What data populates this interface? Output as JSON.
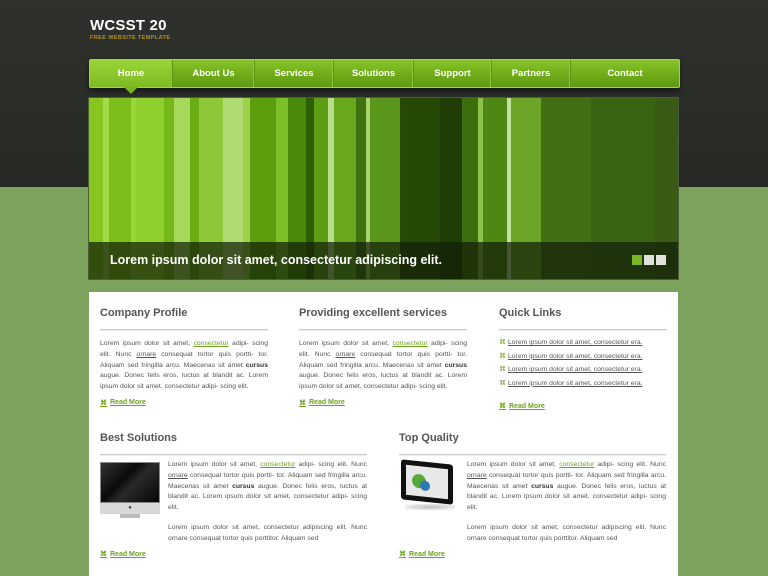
{
  "brand": {
    "title": "WCSST 20",
    "tagline": "FREE WEBSITE TEMPLATE"
  },
  "nav": {
    "items": [
      {
        "label": "Home",
        "active": true
      },
      {
        "label": "About Us"
      },
      {
        "label": "Services"
      },
      {
        "label": "Solutions"
      },
      {
        "label": "Support"
      },
      {
        "label": "Partners"
      },
      {
        "label": "Contact"
      }
    ]
  },
  "slider": {
    "caption": "Lorem ipsum dolor sit amet, consectetur adipiscing elit.",
    "slides": 3,
    "active_slide": 1,
    "stripe_colors": [
      "#86c61f",
      "#a3dc4a",
      "#7dbe1a",
      "#9ad53a",
      "#8fcf2c",
      "#76b817",
      "#a6d95b",
      "#6aad12",
      "#8ec83a",
      "#b0db74",
      "#9bd247",
      "#5c9e0d",
      "#7cbf28",
      "#4a8a0a",
      "#2f5f05",
      "#5d9e17",
      "#b8dd8b",
      "#6aa81d",
      "#3f7310",
      "#a9d46c",
      "#5a961a",
      "#264a06",
      "#1f3d05",
      "#3d6e0e",
      "#8dc24a",
      "#4e8714",
      "#c2e39b",
      "#6da627",
      "#426f14",
      "#3a6412"
    ]
  },
  "profile": {
    "title": "Company Profile",
    "p1": "Lorem ipsum dolor sit amet, ",
    "link": "consectetur",
    "p2": " adipi- scing elit. Nunc ",
    "u": "ornare",
    "p3": " consequat tortor quis portti- tor. Aliquam sed fringilla arcu. Maecenas sit amet ",
    "b": "cursus",
    "p4": " augue. Donec felis eros, luctus at blandit ac. Lorem ipsum dolor sit amet, consectetur adipi- scing elit.",
    "more": "Read More"
  },
  "services": {
    "title": "Providing excellent services",
    "p1": "Lorem ipsum dolor sit amet, ",
    "link": "consectetur",
    "p2": " adipi- scing elit. Nunc ",
    "u": "ornare",
    "p3": " consequat tortor quis portti- tor. Aliquam sed fringilla arcu. Maecenas sit amet ",
    "b": "cursus",
    "p4": " augue. Donec felis eros, luctus at blandit ac. Lorem ipsum dolor sit amet, consectetur adipi- scing elit.",
    "more": "Read More"
  },
  "quicklinks": {
    "title": "Quick Links",
    "links": [
      "Lorem ipsum dolor sit amet, consectetur era.",
      "Lorem ipsum dolor sit amet, consectetur era.",
      "Lorem ipsum dolor sit amet, consectetur era.",
      "Lorem ipsum dolor sit amet, consectetur era."
    ],
    "more": "Read More"
  },
  "best": {
    "title": "Best Solutions",
    "p1": "Lorem ipsum dolor sit amet, ",
    "link": "consectetur",
    "p2": " adipi- scing elit. Nunc ",
    "u": "ornare",
    "p3": " consequat tortor quis portti- tor. Aliquam sed fringilla arcu. Maecenas sit amet ",
    "b": "cursus",
    "p4": " augue. Donec felis eros, luctus at blandit ac. Lorem ipsum dolor sit amet, consectetur adipi- scing elit.",
    "p5": "Lorem ipsum dolor sit amet, consectetur adipiscing elit. Nunc ornare consequat tortor quis porttitor. Aliquam sed",
    "more": "Read More"
  },
  "quality": {
    "title": "Top Quality",
    "p1": "Lorem ipsum dolor sit amet, ",
    "link": "consectetur",
    "p2": " adipi- scing elit. Nunc ",
    "u": "ornare",
    "p3": " consequat tortor quis portti- tor. Aliquam sed fringilla arcu. Maecenas sit amet ",
    "b": "cursus",
    "p4": " augue. Donec felis eros, luctus at blandit ac. Lorem ipsum dolor sit amet, consectetur adipi- scing elit.",
    "p5": "Lorem ipsum dolor sit amet, consectetur adipiscing elit. Nunc ornare consequat tortor quis porttitor. Aliquam sed",
    "more": "Read More"
  },
  "icons": {
    "bullet": "⌘"
  }
}
